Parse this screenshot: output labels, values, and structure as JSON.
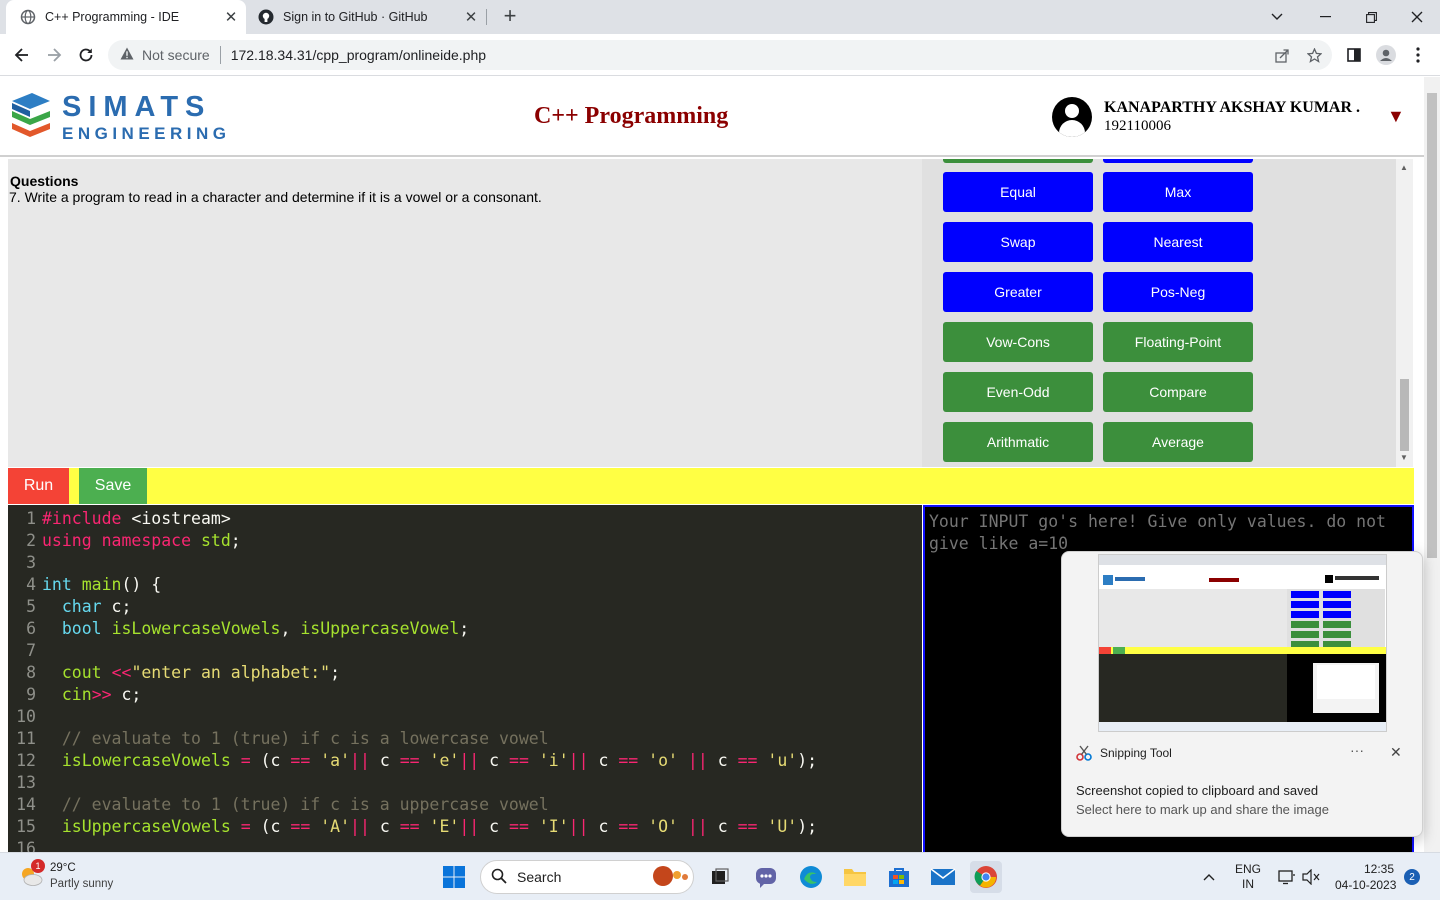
{
  "browser": {
    "tabs": [
      {
        "title": "C++ Programming - IDE",
        "active": true
      },
      {
        "title": "Sign in to GitHub · GitHub",
        "active": false
      }
    ],
    "new_tab": "+",
    "security": "Not secure",
    "url": "172.18.34.31/cpp_program/onlineide.php"
  },
  "header": {
    "logo_line1": "SIMATS",
    "logo_line2": "ENGINEERING",
    "title": "C++ Programming",
    "user_name": "KANAPARTHY AKSHAY KUMAR .",
    "user_id": "192110006",
    "caret": "▼"
  },
  "questions": {
    "heading": "Questions",
    "text": "7. Write a program to read in a character and determine if it is a vowel or a consonant."
  },
  "program_buttons": [
    {
      "label": "Equal",
      "color": "#0000ff"
    },
    {
      "label": "Max",
      "color": "#0000ff"
    },
    {
      "label": "Swap",
      "color": "#0000ff"
    },
    {
      "label": "Nearest",
      "color": "#0000ff"
    },
    {
      "label": "Greater",
      "color": "#0000ff"
    },
    {
      "label": "Pos-Neg",
      "color": "#0000ff"
    },
    {
      "label": "Vow-Cons",
      "color": "#3c8f3c"
    },
    {
      "label": "Floating-Point",
      "color": "#3c8f3c"
    },
    {
      "label": "Even-Odd",
      "color": "#3c8f3c"
    },
    {
      "label": "Compare",
      "color": "#3c8f3c"
    },
    {
      "label": "Arithmatic",
      "color": "#3c8f3c"
    },
    {
      "label": "Average",
      "color": "#3c8f3c"
    }
  ],
  "actions": {
    "run": "Run",
    "save": "Save"
  },
  "editor": {
    "lines": [
      {
        "n": "1",
        "code": "#include <iostream>"
      },
      {
        "n": "2",
        "code": "using namespace std;"
      },
      {
        "n": "3",
        "code": ""
      },
      {
        "n": "4",
        "code": "int main() {"
      },
      {
        "n": "5",
        "code": "  char c;"
      },
      {
        "n": "6",
        "code": "  bool isLowercaseVowels, isUppercaseVowel;"
      },
      {
        "n": "7",
        "code": ""
      },
      {
        "n": "8",
        "code": "  cout <<\"enter an alphabet:\";"
      },
      {
        "n": "9",
        "code": "  cin>> c;"
      },
      {
        "n": "10",
        "code": ""
      },
      {
        "n": "11",
        "code": "  // evaluate to 1 (true) if c is a lowercase vowel"
      },
      {
        "n": "12",
        "code": "  isLowercaseVowels = (c == 'a'|| c == 'e'|| c == 'i'|| c == 'o' || c == 'u');"
      },
      {
        "n": "13",
        "code": ""
      },
      {
        "n": "14",
        "code": "  // evaluate to 1 (true) if c is a uppercase vowel"
      },
      {
        "n": "15",
        "code": "  isUppercaseVowels = (c == 'A'|| c == 'E'|| c == 'I'|| c == 'O' || c == 'U');"
      },
      {
        "n": "16",
        "code": ""
      }
    ]
  },
  "input_box": {
    "placeholder": "Your INPUT go's here! Give only values. do not give like a=10"
  },
  "toast": {
    "app": "Snipping Tool",
    "more": "···",
    "title": "Screenshot copied to clipboard and saved",
    "subtitle": "Select here to mark up and share the image"
  },
  "taskbar": {
    "weather_badge": "1",
    "temperature": "29°C",
    "weather": "Partly sunny",
    "search": "Search",
    "lang_top": "ENG",
    "lang_bottom": "IN",
    "time": "12:35",
    "date": "04-10-2023",
    "notifications": "2"
  }
}
